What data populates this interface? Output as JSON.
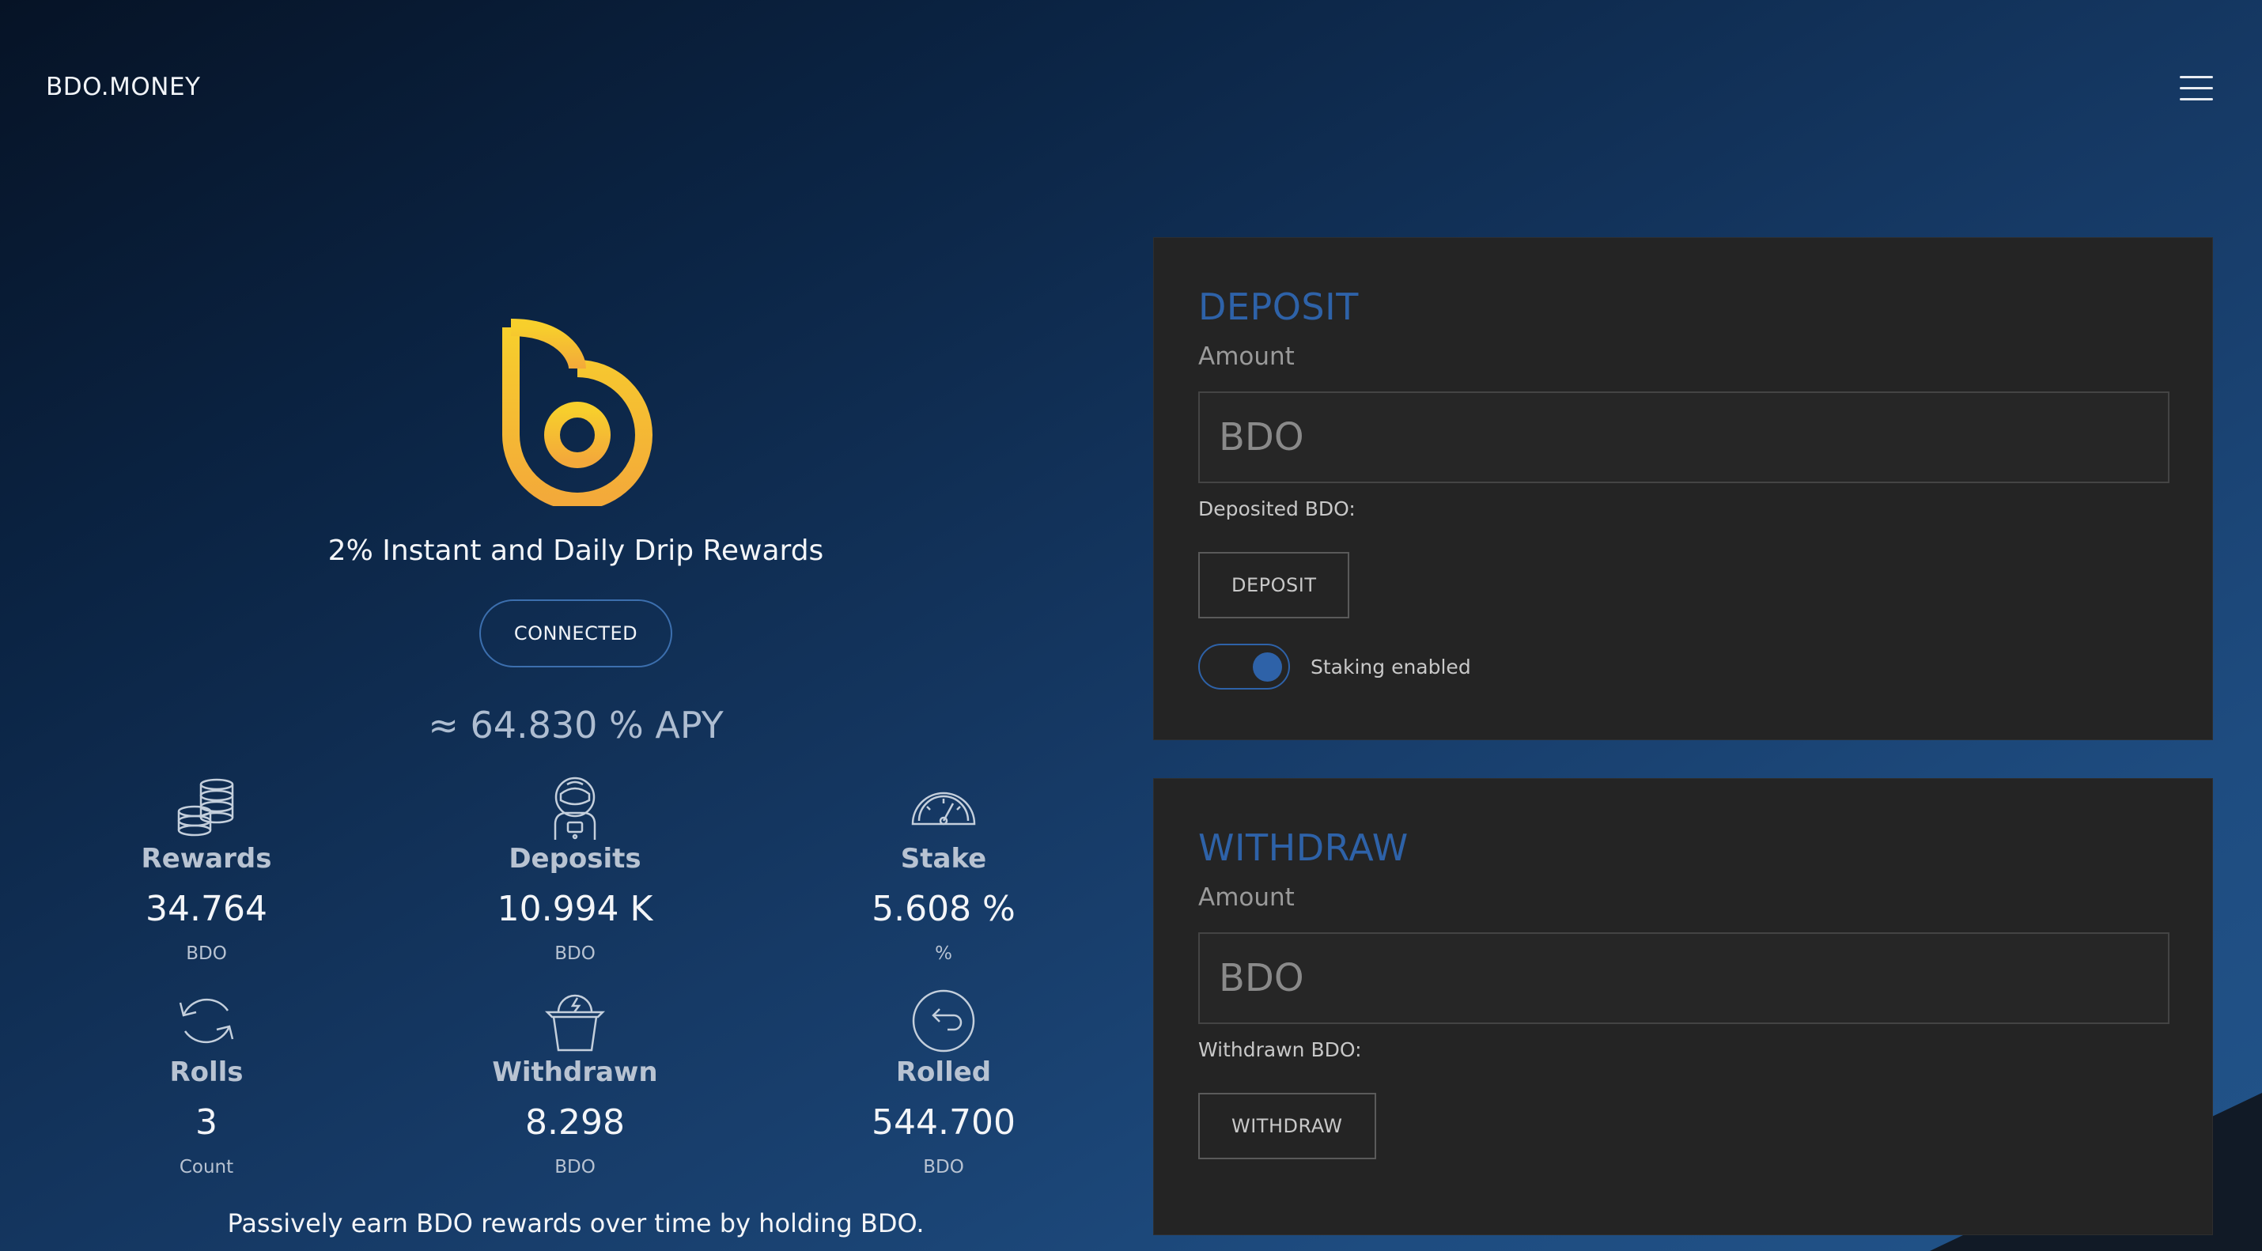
{
  "header": {
    "brand": "BDO.MONEY"
  },
  "hero": {
    "tagline": "2% Instant and Daily Drip Rewards",
    "connect_label": "CONNECTED",
    "apy": "≈ 64.830 % APY",
    "footnote": "Passively earn BDO rewards over time by holding BDO."
  },
  "stats": [
    {
      "label": "Rewards",
      "value": "34.764",
      "unit": "BDO",
      "icon": "coins-icon"
    },
    {
      "label": "Deposits",
      "value": "10.994 K",
      "unit": "BDO",
      "icon": "astronaut-icon"
    },
    {
      "label": "Stake",
      "value": "5.608 %",
      "unit": "%",
      "icon": "gauge-icon"
    },
    {
      "label": "Rolls",
      "value": "3",
      "unit": "Count",
      "icon": "refresh-icon"
    },
    {
      "label": "Withdrawn",
      "value": "8.298",
      "unit": "BDO",
      "icon": "basket-icon"
    },
    {
      "label": "Rolled",
      "value": "544.700",
      "unit": "BDO",
      "icon": "return-arrow-icon"
    }
  ],
  "deposit": {
    "title": "DEPOSIT",
    "amount_label": "Amount",
    "placeholder": "BDO",
    "info_label": "Deposited BDO:",
    "button_label": "DEPOSIT",
    "toggle_label": "Staking enabled",
    "toggle_on": true
  },
  "withdraw": {
    "title": "WITHDRAW",
    "amount_label": "Amount",
    "placeholder": "BDO",
    "info_label": "Withdrawn BDO:",
    "button_label": "WITHDRAW"
  },
  "colors": {
    "accent": "#2e62a8",
    "logo_gold": "#f5c32c",
    "card_bg": "#242424"
  }
}
